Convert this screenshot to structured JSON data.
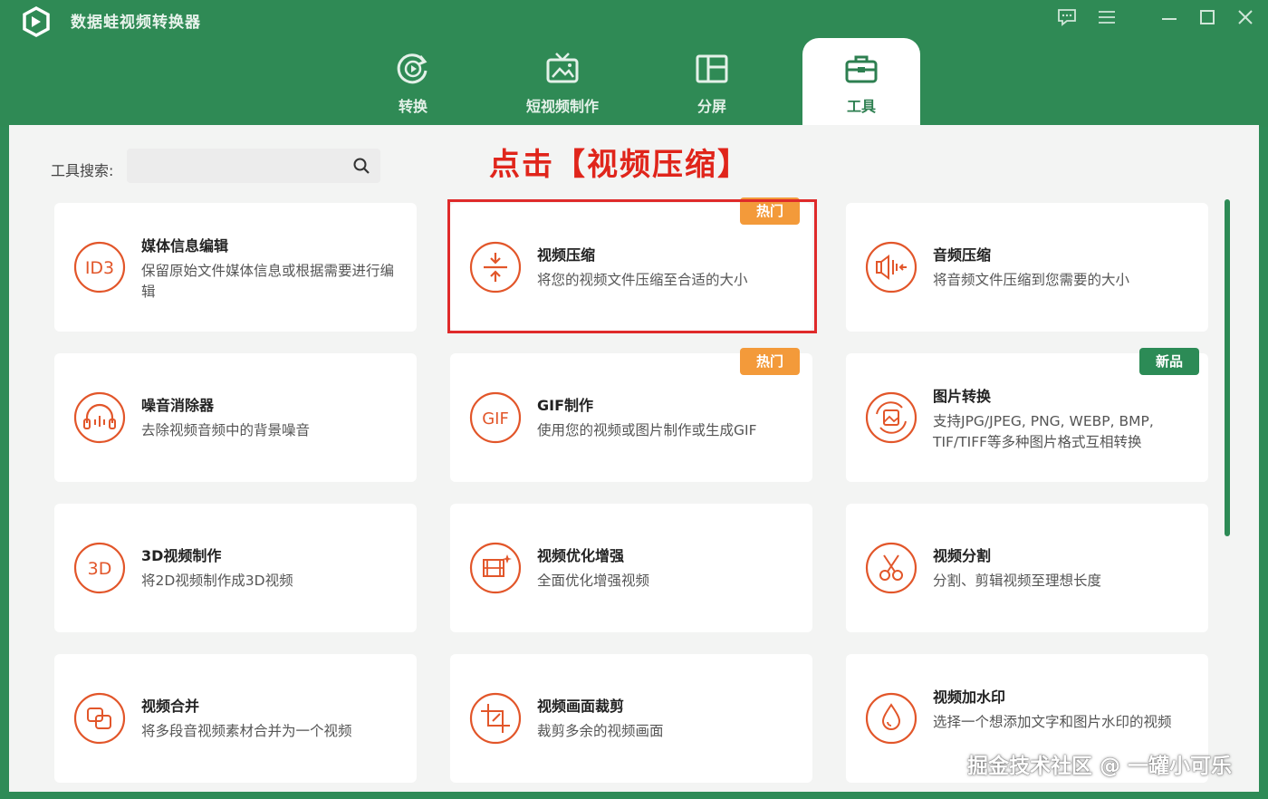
{
  "app": {
    "title": "数据蛙视频转换器"
  },
  "window_controls": {
    "feedback": "feedback-icon",
    "menu": "menu-icon",
    "minimize": "minimize-icon",
    "maximize": "maximize-icon",
    "close": "close-icon"
  },
  "tabs": [
    {
      "label": "转换",
      "icon": "convert-icon"
    },
    {
      "label": "短视频制作",
      "icon": "short-video-icon"
    },
    {
      "label": "分屏",
      "icon": "split-screen-icon"
    },
    {
      "label": "工具",
      "icon": "toolbox-icon",
      "active": true
    }
  ],
  "search": {
    "label": "工具搜索:",
    "value": "",
    "placeholder": ""
  },
  "annotation": "点击【视频压缩】",
  "badges": {
    "hot": "热门",
    "new": "新品"
  },
  "tools": [
    {
      "title": "媒体信息编辑",
      "desc": "保留原始文件媒体信息或根据需要进行编辑",
      "icon": "id3-icon"
    },
    {
      "title": "视频压缩",
      "desc": "将您的视频文件压缩至合适的大小",
      "icon": "compress-icon",
      "badge": "热门",
      "highlighted": true
    },
    {
      "title": "音频压缩",
      "desc": "将音频文件压缩到您需要的大小",
      "icon": "audio-compress-icon"
    },
    {
      "title": "噪音消除器",
      "desc": "去除视频音频中的背景噪音",
      "icon": "headphone-icon"
    },
    {
      "title": "GIF制作",
      "desc": "使用您的视频或图片制作或生成GIF",
      "icon": "gif-icon",
      "badge": "热门"
    },
    {
      "title": "图片转换",
      "desc": "支持JPG/JPEG, PNG, WEBP, BMP, TIF/TIFF等多种图片格式互相转换",
      "icon": "image-convert-icon",
      "badge": "新品"
    },
    {
      "title": "3D视频制作",
      "desc": "将2D视频制作成3D视频",
      "icon": "3d-icon"
    },
    {
      "title": "视频优化增强",
      "desc": "全面优化增强视频",
      "icon": "enhance-icon"
    },
    {
      "title": "视频分割",
      "desc": "分割、剪辑视频至理想长度",
      "icon": "scissors-icon"
    },
    {
      "title": "视频合并",
      "desc": "将多段音视频素材合并为一个视频",
      "icon": "merge-icon"
    },
    {
      "title": "视频画面裁剪",
      "desc": "裁剪多余的视频画面",
      "icon": "crop-icon"
    },
    {
      "title": "视频加水印",
      "desc": "选择一个想添加文字和图片水印的视频",
      "icon": "watermark-icon"
    }
  ],
  "icon_text": {
    "id3": "ID3",
    "gif": "GIF",
    "three_d": "3D"
  },
  "watermark": "掘金技术社区 @ 一罐小可乐",
  "colors": {
    "brand_green": "#2f8a55",
    "accent_orange": "#e2562a",
    "hot_badge": "#f39a3a",
    "highlight_red": "#df2a2a"
  }
}
